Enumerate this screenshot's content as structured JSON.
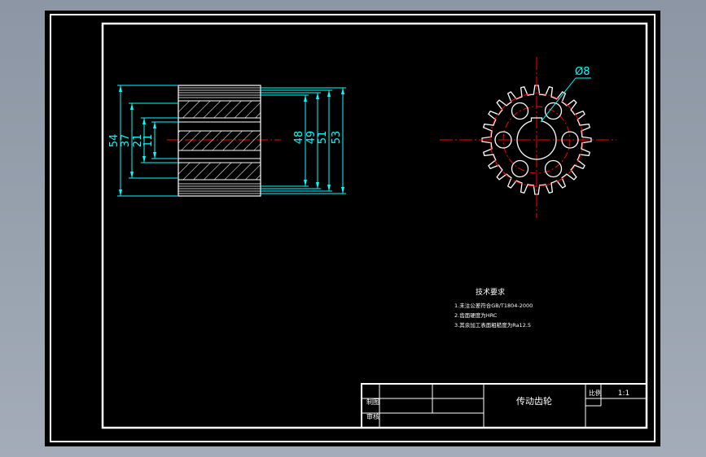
{
  "colors": {
    "background_outer": "#a0a8b4",
    "sheet": "#000000",
    "border": "#ffffff",
    "dimension": "#00ffff",
    "centerline": "#ff0000",
    "outline": "#ffffff"
  },
  "side_view": {
    "dimensions_left": [
      "54",
      "37",
      "21",
      "11"
    ],
    "dimensions_right": [
      "48",
      "49",
      "51",
      "53"
    ]
  },
  "front_view": {
    "hole_callout": "Ø8",
    "tooth_count": 24
  },
  "tech_requirements": {
    "title": "技术要求",
    "items": [
      "1.未注公差符合GB/T1804-2000",
      "2.齿面硬度为HRC",
      "3.其余加工表面粗糙度为Ra12.5"
    ]
  },
  "title_block": {
    "part_name": "传动齿轮",
    "scale_label": "比例",
    "scale_value": "1:1",
    "role_labels": [
      "制图",
      "审核"
    ]
  }
}
